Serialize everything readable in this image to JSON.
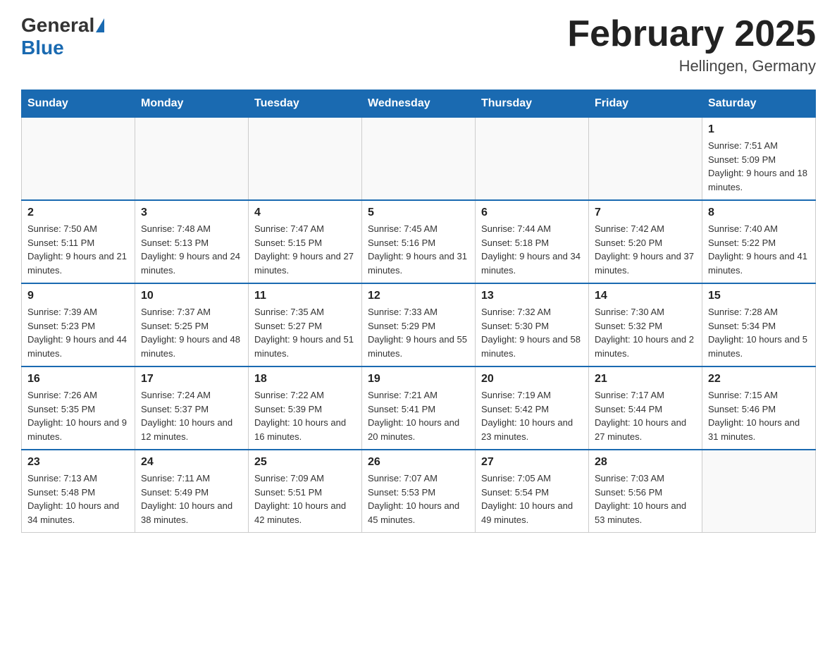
{
  "header": {
    "title": "February 2025",
    "location": "Hellingen, Germany",
    "logo_general": "General",
    "logo_blue": "Blue"
  },
  "days_of_week": [
    "Sunday",
    "Monday",
    "Tuesday",
    "Wednesday",
    "Thursday",
    "Friday",
    "Saturday"
  ],
  "weeks": [
    {
      "days": [
        {
          "number": "",
          "info": ""
        },
        {
          "number": "",
          "info": ""
        },
        {
          "number": "",
          "info": ""
        },
        {
          "number": "",
          "info": ""
        },
        {
          "number": "",
          "info": ""
        },
        {
          "number": "",
          "info": ""
        },
        {
          "number": "1",
          "info": "Sunrise: 7:51 AM\nSunset: 5:09 PM\nDaylight: 9 hours and 18 minutes."
        }
      ]
    },
    {
      "days": [
        {
          "number": "2",
          "info": "Sunrise: 7:50 AM\nSunset: 5:11 PM\nDaylight: 9 hours and 21 minutes."
        },
        {
          "number": "3",
          "info": "Sunrise: 7:48 AM\nSunset: 5:13 PM\nDaylight: 9 hours and 24 minutes."
        },
        {
          "number": "4",
          "info": "Sunrise: 7:47 AM\nSunset: 5:15 PM\nDaylight: 9 hours and 27 minutes."
        },
        {
          "number": "5",
          "info": "Sunrise: 7:45 AM\nSunset: 5:16 PM\nDaylight: 9 hours and 31 minutes."
        },
        {
          "number": "6",
          "info": "Sunrise: 7:44 AM\nSunset: 5:18 PM\nDaylight: 9 hours and 34 minutes."
        },
        {
          "number": "7",
          "info": "Sunrise: 7:42 AM\nSunset: 5:20 PM\nDaylight: 9 hours and 37 minutes."
        },
        {
          "number": "8",
          "info": "Sunrise: 7:40 AM\nSunset: 5:22 PM\nDaylight: 9 hours and 41 minutes."
        }
      ]
    },
    {
      "days": [
        {
          "number": "9",
          "info": "Sunrise: 7:39 AM\nSunset: 5:23 PM\nDaylight: 9 hours and 44 minutes."
        },
        {
          "number": "10",
          "info": "Sunrise: 7:37 AM\nSunset: 5:25 PM\nDaylight: 9 hours and 48 minutes."
        },
        {
          "number": "11",
          "info": "Sunrise: 7:35 AM\nSunset: 5:27 PM\nDaylight: 9 hours and 51 minutes."
        },
        {
          "number": "12",
          "info": "Sunrise: 7:33 AM\nSunset: 5:29 PM\nDaylight: 9 hours and 55 minutes."
        },
        {
          "number": "13",
          "info": "Sunrise: 7:32 AM\nSunset: 5:30 PM\nDaylight: 9 hours and 58 minutes."
        },
        {
          "number": "14",
          "info": "Sunrise: 7:30 AM\nSunset: 5:32 PM\nDaylight: 10 hours and 2 minutes."
        },
        {
          "number": "15",
          "info": "Sunrise: 7:28 AM\nSunset: 5:34 PM\nDaylight: 10 hours and 5 minutes."
        }
      ]
    },
    {
      "days": [
        {
          "number": "16",
          "info": "Sunrise: 7:26 AM\nSunset: 5:35 PM\nDaylight: 10 hours and 9 minutes."
        },
        {
          "number": "17",
          "info": "Sunrise: 7:24 AM\nSunset: 5:37 PM\nDaylight: 10 hours and 12 minutes."
        },
        {
          "number": "18",
          "info": "Sunrise: 7:22 AM\nSunset: 5:39 PM\nDaylight: 10 hours and 16 minutes."
        },
        {
          "number": "19",
          "info": "Sunrise: 7:21 AM\nSunset: 5:41 PM\nDaylight: 10 hours and 20 minutes."
        },
        {
          "number": "20",
          "info": "Sunrise: 7:19 AM\nSunset: 5:42 PM\nDaylight: 10 hours and 23 minutes."
        },
        {
          "number": "21",
          "info": "Sunrise: 7:17 AM\nSunset: 5:44 PM\nDaylight: 10 hours and 27 minutes."
        },
        {
          "number": "22",
          "info": "Sunrise: 7:15 AM\nSunset: 5:46 PM\nDaylight: 10 hours and 31 minutes."
        }
      ]
    },
    {
      "days": [
        {
          "number": "23",
          "info": "Sunrise: 7:13 AM\nSunset: 5:48 PM\nDaylight: 10 hours and 34 minutes."
        },
        {
          "number": "24",
          "info": "Sunrise: 7:11 AM\nSunset: 5:49 PM\nDaylight: 10 hours and 38 minutes."
        },
        {
          "number": "25",
          "info": "Sunrise: 7:09 AM\nSunset: 5:51 PM\nDaylight: 10 hours and 42 minutes."
        },
        {
          "number": "26",
          "info": "Sunrise: 7:07 AM\nSunset: 5:53 PM\nDaylight: 10 hours and 45 minutes."
        },
        {
          "number": "27",
          "info": "Sunrise: 7:05 AM\nSunset: 5:54 PM\nDaylight: 10 hours and 49 minutes."
        },
        {
          "number": "28",
          "info": "Sunrise: 7:03 AM\nSunset: 5:56 PM\nDaylight: 10 hours and 53 minutes."
        },
        {
          "number": "",
          "info": ""
        }
      ]
    }
  ]
}
